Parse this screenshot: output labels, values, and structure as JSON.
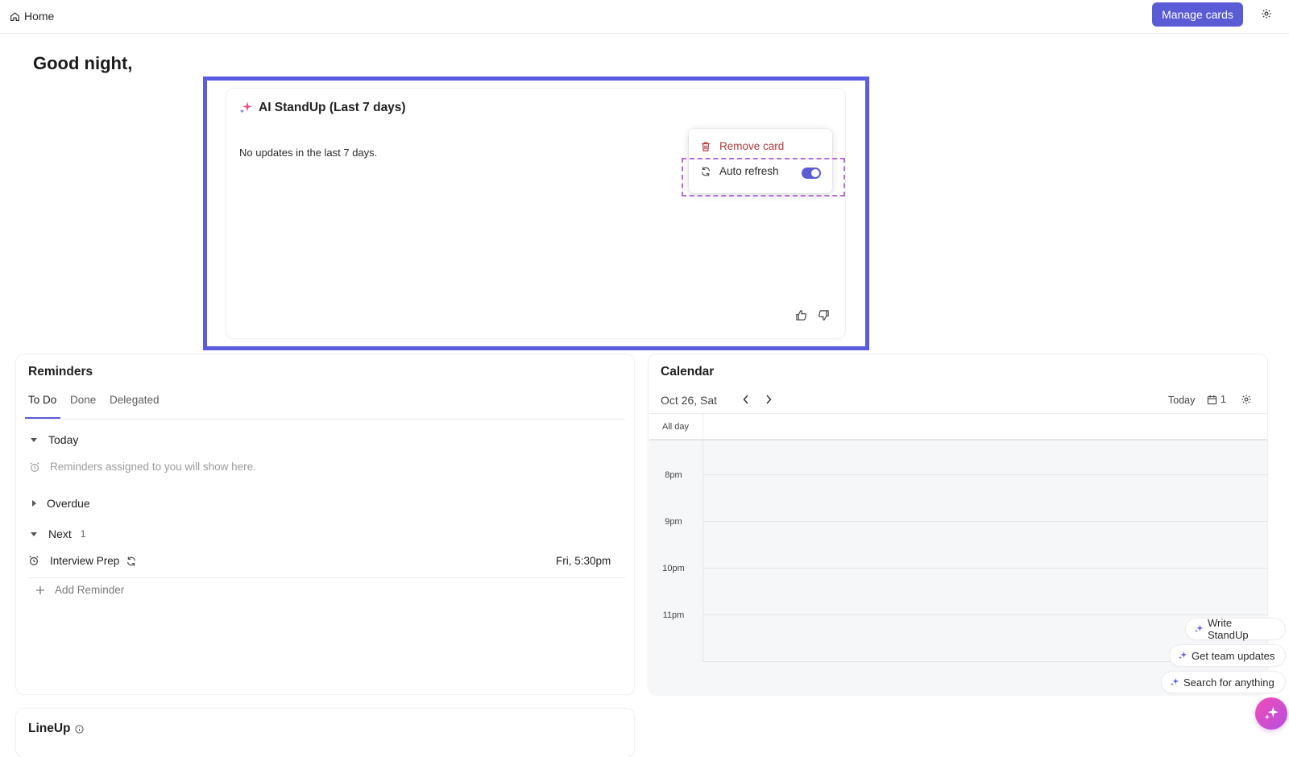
{
  "topbar": {
    "breadcrumb": "Home",
    "manage_cards_label": "Manage cards"
  },
  "greeting": "Good night,",
  "ai_standup": {
    "title": "AI StandUp (Last 7 days)",
    "empty_text": "No updates in the last 7 days."
  },
  "card_menu": {
    "remove_label": "Remove card",
    "auto_refresh_label": "Auto refresh",
    "auto_refresh_on": true
  },
  "reminders": {
    "title": "Reminders",
    "tabs": [
      {
        "label": "To Do",
        "active": true
      },
      {
        "label": "Done",
        "active": false
      },
      {
        "label": "Delegated",
        "active": false
      }
    ],
    "groups": {
      "today": {
        "label": "Today",
        "empty_text": "Reminders assigned to you will show here."
      },
      "overdue": {
        "label": "Overdue"
      },
      "next": {
        "label": "Next",
        "count": "1"
      }
    },
    "items": [
      {
        "name": "Interview Prep",
        "time": "Fri, 5:30pm",
        "recurring": true
      }
    ],
    "add_label": "Add Reminder"
  },
  "calendar": {
    "title": "Calendar",
    "date": "Oct 26, Sat",
    "today_label": "Today",
    "view_days": "1",
    "all_day_label": "All day",
    "hours": [
      "8pm",
      "9pm",
      "10pm",
      "11pm"
    ]
  },
  "lineup": {
    "title": "LineUp"
  },
  "ai_actions": [
    "Write StandUp",
    "Get team updates",
    "Search for anything"
  ],
  "colors": {
    "accent": "#5b5bd6",
    "danger": "#b23a3a",
    "focus_frame": "#5b5be0",
    "focus_dashed": "#b86bd6"
  },
  "icons": {
    "home": "home-icon",
    "settings": "gear-icon",
    "sparkle": "sparkle-icon",
    "trash": "trash-icon",
    "refresh": "refresh-icon",
    "like": "thumbs-up-icon",
    "dislike": "thumbs-down-icon",
    "alarm": "alarm-clock-icon",
    "add": "plus-icon",
    "calendar": "calendar-icon",
    "info": "info-icon"
  }
}
